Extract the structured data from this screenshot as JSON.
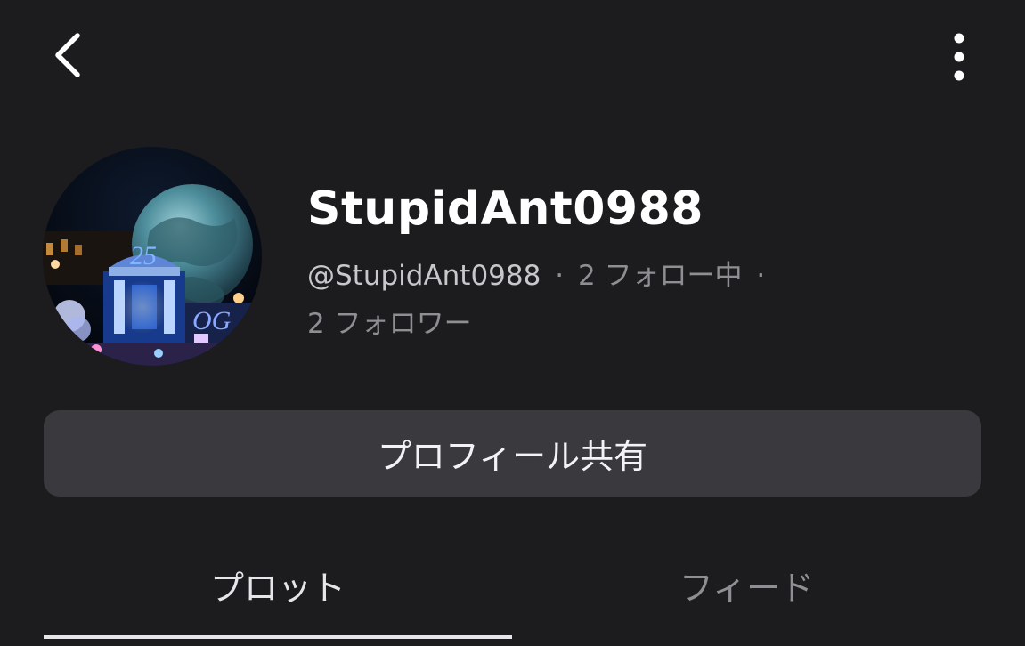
{
  "header": {
    "back_icon": "chevron-left-icon",
    "more_icon": "more-vertical-icon"
  },
  "profile": {
    "avatar_icon": "avatar-night-parade-image",
    "username": "StupidAnt0988",
    "handle": "@StupidAnt0988",
    "separator": "·",
    "following": "2 フォロー中",
    "followers": "2 フォロワー"
  },
  "actions": {
    "share_label": "プロフィール共有"
  },
  "tabs": [
    {
      "label": "プロット",
      "selected": true
    },
    {
      "label": "フィード",
      "selected": false
    }
  ],
  "colors": {
    "background": "#1c1c1e",
    "button": "#3a3a3e",
    "muted_text": "#8e8e93",
    "primary_text": "#ffffff"
  }
}
